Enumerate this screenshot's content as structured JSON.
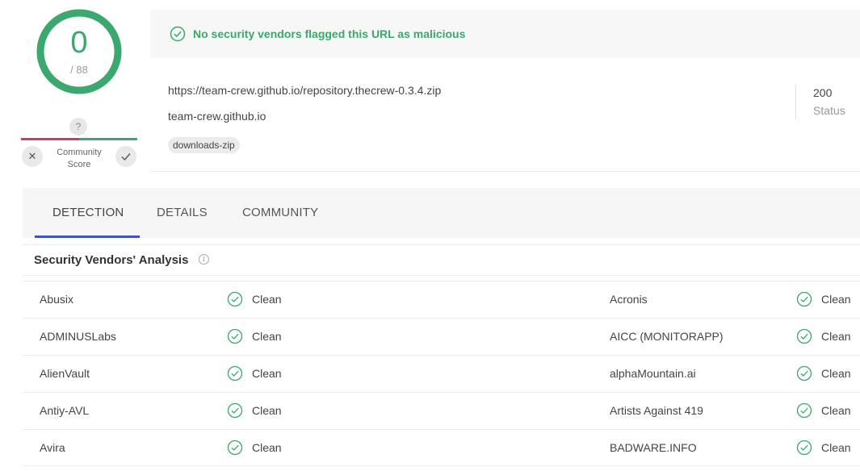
{
  "score": {
    "detections": "0",
    "total": "/ 88",
    "color": "#3ba86e"
  },
  "community": {
    "unknown_symbol": "?",
    "label_line1": "Community",
    "label_line2": "Score"
  },
  "banner": {
    "message": "No security vendors flagged this URL as malicious",
    "icon": "check-circle-icon"
  },
  "url_info": {
    "url": "https://team-crew.github.io/repository.thecrew-0.3.4.zip",
    "domain": "team-crew.github.io",
    "tag": "downloads-zip",
    "status_code": "200",
    "status_label": "Status"
  },
  "tabs": [
    {
      "label": "DETECTION",
      "active": true
    },
    {
      "label": "DETAILS",
      "active": false
    },
    {
      "label": "COMMUNITY",
      "active": false
    }
  ],
  "section": {
    "title": "Security Vendors' Analysis",
    "info_symbol": "i"
  },
  "vendors": [
    {
      "left": {
        "name": "Abusix",
        "result": "Clean"
      },
      "right": {
        "name": "Acronis",
        "result": "Clean"
      }
    },
    {
      "left": {
        "name": "ADMINUSLabs",
        "result": "Clean"
      },
      "right": {
        "name": "AICC (MONITORAPP)",
        "result": "Clean"
      }
    },
    {
      "left": {
        "name": "AlienVault",
        "result": "Clean"
      },
      "right": {
        "name": "alphaMountain.ai",
        "result": "Clean"
      }
    },
    {
      "left": {
        "name": "Antiy-AVL",
        "result": "Clean"
      },
      "right": {
        "name": "Artists Against 419",
        "result": "Clean"
      }
    },
    {
      "left": {
        "name": "Avira",
        "result": "Clean"
      },
      "right": {
        "name": "BADWARE.INFO",
        "result": "Clean"
      }
    }
  ],
  "colors": {
    "clean": "#3ba86e",
    "malicious": "#d63b57",
    "tab_accent": "#3f51c6"
  }
}
